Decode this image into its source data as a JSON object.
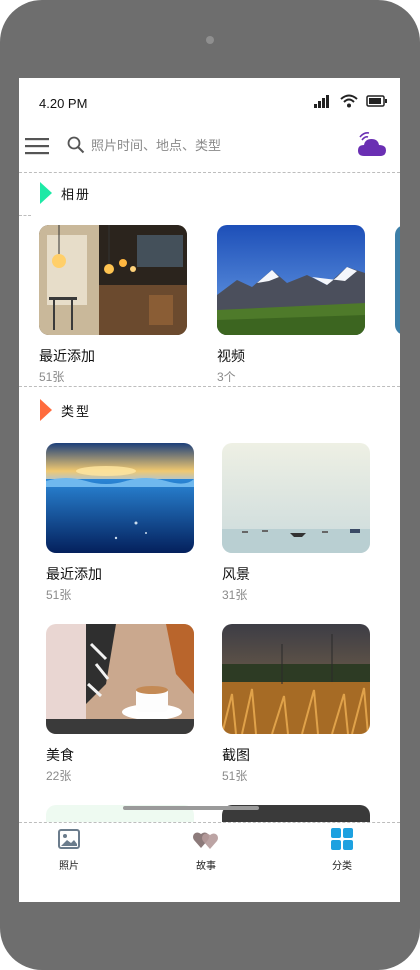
{
  "status": {
    "time": "4.20 PM"
  },
  "search": {
    "placeholder": "照片时间、地点、类型"
  },
  "albums": {
    "title": "相册",
    "accent": "#1de9a6",
    "items": [
      {
        "name": "最近添加",
        "count": "51张"
      },
      {
        "name": "视频",
        "count": "3个"
      }
    ]
  },
  "types": {
    "title": "类型",
    "accent": "#ff6b3d",
    "items": [
      {
        "name": "最近添加",
        "count": "51张"
      },
      {
        "name": "风景",
        "count": "31张"
      },
      {
        "name": "美食",
        "count": "22张"
      },
      {
        "name": "截图",
        "count": "51张"
      }
    ]
  },
  "tabs": [
    {
      "label": "照片",
      "icon": "photo-icon"
    },
    {
      "label": "故事",
      "icon": "hearts-icon"
    },
    {
      "label": "分类",
      "icon": "grid-icon",
      "active_color": "#1da1e0"
    }
  ]
}
